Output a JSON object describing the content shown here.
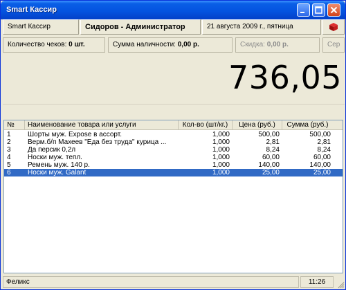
{
  "window": {
    "title": "Smart Кассир"
  },
  "info": {
    "app_name": "Smart Кассир",
    "user": "Сидоров - Администратор",
    "date": "21 августа 2009 г., пятница"
  },
  "counters": {
    "checks_label": "Количество чеков:",
    "checks_value": "0 шт.",
    "cash_label": "Сумма наличности:",
    "cash_value": "0,00 р.",
    "discount_label": "Скидка:",
    "discount_value": "0,00 р.",
    "extra_label": "Сер"
  },
  "total": "736,05",
  "table": {
    "columns": [
      "№",
      "Наименование товара или услуги",
      "Кол-во (шт/кг.)",
      "Цена (руб.)",
      "Сумма (руб.)"
    ],
    "rows": [
      [
        "1",
        "Шорты муж. Expose в ассорт.",
        "1,000",
        "500,00",
        "500,00"
      ],
      [
        "2",
        "Верм.б/п Махеев \"Еда без труда\" курица ...",
        "1,000",
        "2,81",
        "2,81"
      ],
      [
        "3",
        "Да персик 0,2л",
        "1,000",
        "8,24",
        "8,24"
      ],
      [
        "4",
        "Носки муж. тепл.",
        "1,000",
        "60,00",
        "60,00"
      ],
      [
        "5",
        "Ремень муж. 140 р.",
        "1,000",
        "140,00",
        "140,00"
      ],
      [
        "6",
        "Носки муж. Galant",
        "1,000",
        "25,00",
        "25,00"
      ]
    ],
    "selected_index": 5
  },
  "status": {
    "user": "Феликс",
    "time": "11:26"
  },
  "colors": {
    "selection": "#316ac5",
    "titlebar": "#0454e0"
  }
}
